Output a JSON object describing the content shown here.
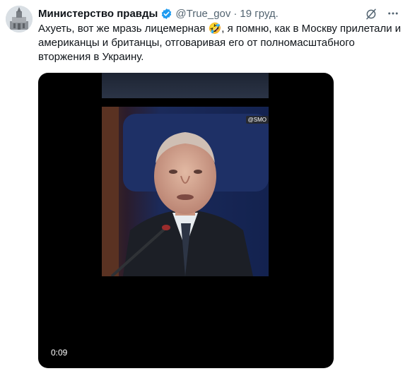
{
  "author": {
    "display_name": "Министерство правды",
    "handle": "@True_gov",
    "separator": "·",
    "date": "19 груд."
  },
  "tweet": {
    "text": "Ахуеть, вот же мразь лицемерная 🤣, я помню, как в Москву прилетали и американцы и британцы, отговаривая его от полномасштабного вторжения в Украину."
  },
  "media": {
    "watermark": "@SMO",
    "duration": "0:09"
  },
  "icons": {
    "verified": "verified-badge-icon",
    "grok": "grok-icon",
    "more": "more-options-icon"
  },
  "colors": {
    "verified": "#1d9bf0",
    "secondary_text": "#536471",
    "media_background": "#000000"
  }
}
